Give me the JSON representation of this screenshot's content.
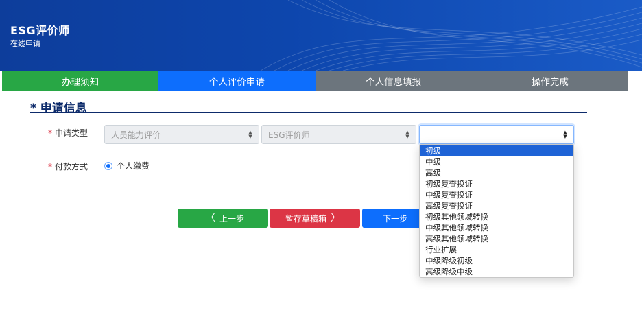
{
  "header": {
    "title": "ESG评价师",
    "subtitle": "在线申请"
  },
  "steps": [
    {
      "label": "办理须知",
      "state": "done"
    },
    {
      "label": "个人评价申请",
      "state": "active"
    },
    {
      "label": "个人信息填报",
      "state": "todo"
    },
    {
      "label": "操作完成",
      "state": "todo"
    }
  ],
  "section": {
    "title": "* 申请信息"
  },
  "form": {
    "type_label": "申请类型",
    "type_select_1": "人员能力评价",
    "type_select_2": "ESG评价师",
    "type_select_3": "",
    "pay_label": "付款方式",
    "pay_option": "个人缴费"
  },
  "buttons": {
    "prev": "上一步",
    "save": "暂存草稿箱",
    "next": "下一步"
  },
  "dropdown_options": [
    "初级",
    "中级",
    "高级",
    "初级复查换证",
    "中级复查换证",
    "高级复查换证",
    "初级其他领域转换",
    "中级其他领域转换",
    "高级其他领域转换",
    "行业扩展",
    "中级降级初级",
    "高级降级中级"
  ],
  "colors": {
    "banner": "#0d46ad",
    "step_done": "#28a745",
    "step_active": "#0d6efd",
    "step_todo": "#6c757d",
    "danger": "#dc3545",
    "highlight": "#1e63d6"
  }
}
